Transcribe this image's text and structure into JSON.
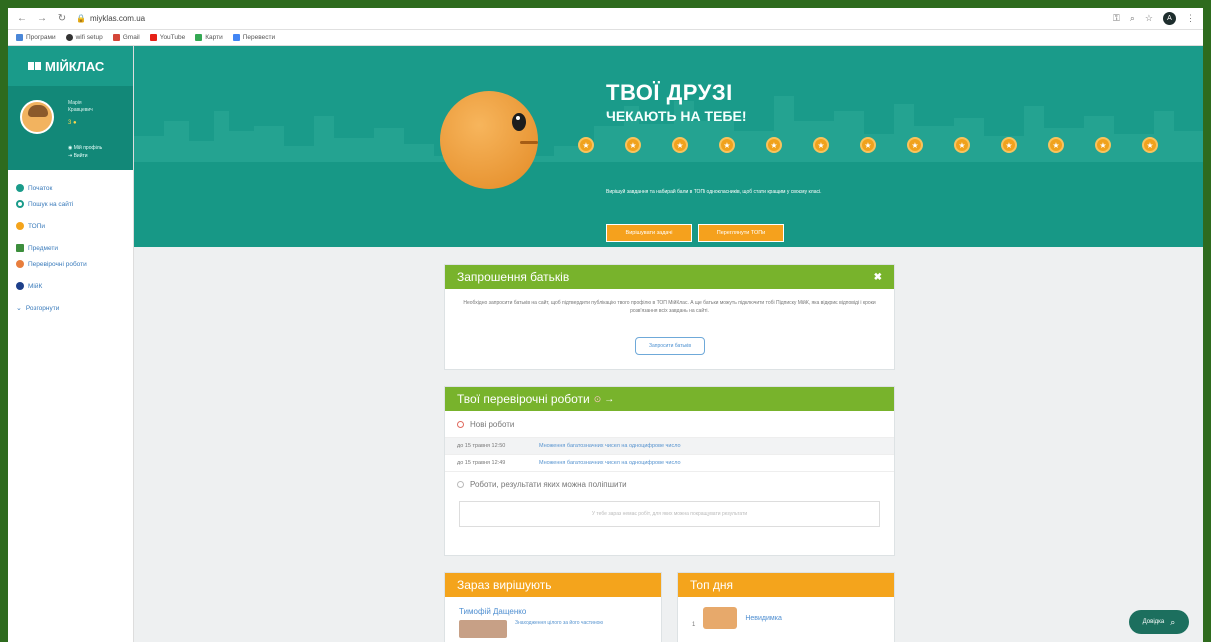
{
  "browser": {
    "url": "miyklas.com.ua",
    "bookmarks": [
      "Програми",
      "wifi setup",
      "Gmail",
      "YouTube",
      "Карти",
      "Перевести"
    ]
  },
  "sidebar": {
    "logo": "МІЙКЛАС",
    "profile": {
      "name_line1": "Марія",
      "name_line2": "Кравцевич",
      "stars": "3",
      "link_profile": "Мій профіль",
      "link_logout": "Вийти"
    },
    "items": [
      {
        "label": "Початок"
      },
      {
        "label": "Пошук на сайті"
      },
      {
        "label": "ТОПи"
      },
      {
        "label": "Предмети"
      },
      {
        "label": "Перевірочні роботи"
      },
      {
        "label": "МійК"
      },
      {
        "label": "Розгорнути"
      }
    ]
  },
  "banner": {
    "title": "ТВОЇ ДРУЗІ",
    "subtitle": "ЧЕКАЮТЬ НА ТЕБЕ!",
    "description": "Вирішуй завдання та набирай бали в ТОПі однокласників, щоб стати кращим у своєму класі.",
    "btn_solve": "Вирішувати задачі",
    "btn_tops": "Переглянути ТОПи"
  },
  "invite_card": {
    "title": "Запрошення батьків",
    "text": "Необхідно запросити батьків на сайт, щоб підтвердити публікацію твого профілю в ТОП МійКлас. А ще батьки можуть підключити тобі Підписку МійК, яка відкриє відповіді і кроки розв'язання всіх завдань на сайті.",
    "button": "Запросити батьків"
  },
  "tests_card": {
    "title": "Твої перевірочні роботи",
    "new_label": "Нові роботи",
    "tasks": [
      {
        "date": "до 15 травня 12:50",
        "link": "Множення багатозначних чисел на одноцифрове число"
      },
      {
        "date": "до 15 травня 12:49",
        "link": "Множення багатозначних чисел на одноцифрове число"
      }
    ],
    "improve_label": "Роботи, результати яких можна поліпшити",
    "empty_text": "У тебе зараз немає робіт, для яких можна покращувати результати"
  },
  "solving_card": {
    "title": "Зараз вирішують",
    "name": "Тимофій Дащенко",
    "task": "Знаходження цілого за його частиною"
  },
  "top_card": {
    "title": "Топ дня",
    "name": "Невидимка"
  },
  "help": {
    "label": "Довідка"
  }
}
